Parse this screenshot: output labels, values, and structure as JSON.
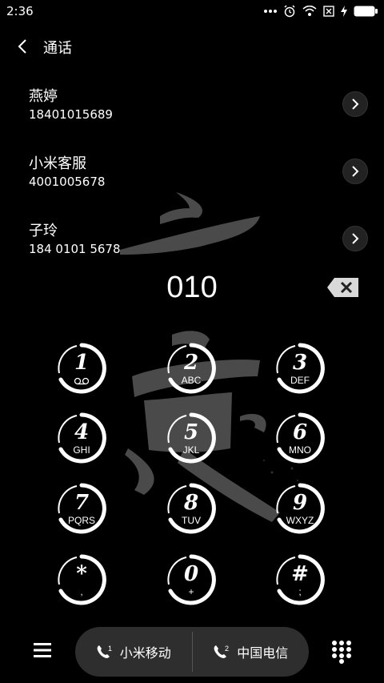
{
  "status_bar": {
    "time": "2:36"
  },
  "header": {
    "title": "通话",
    "back_icon": "chevron-left-icon"
  },
  "contacts": [
    {
      "name": "燕婷",
      "number": "18401015689"
    },
    {
      "name": "小米客服",
      "number": "4001005678"
    },
    {
      "name": "子玲",
      "number": "184 0101 5678"
    }
  ],
  "dialer": {
    "input": "010"
  },
  "keypad": [
    {
      "digit": "1",
      "letters": ""
    },
    {
      "digit": "2",
      "letters": "ABC"
    },
    {
      "digit": "3",
      "letters": "DEF"
    },
    {
      "digit": "4",
      "letters": "GHI"
    },
    {
      "digit": "5",
      "letters": "JKL"
    },
    {
      "digit": "6",
      "letters": "MNO"
    },
    {
      "digit": "7",
      "letters": "PQRS"
    },
    {
      "digit": "8",
      "letters": "TUV"
    },
    {
      "digit": "9",
      "letters": "WXYZ"
    },
    {
      "digit": "*",
      "letters": ","
    },
    {
      "digit": "0",
      "letters": "+"
    },
    {
      "digit": "#",
      "letters": ";"
    }
  ],
  "bottom_bar": {
    "sim1_index": "1",
    "sim1_label": "小米移动",
    "sim2_index": "2",
    "sim2_label": "中国电信"
  }
}
